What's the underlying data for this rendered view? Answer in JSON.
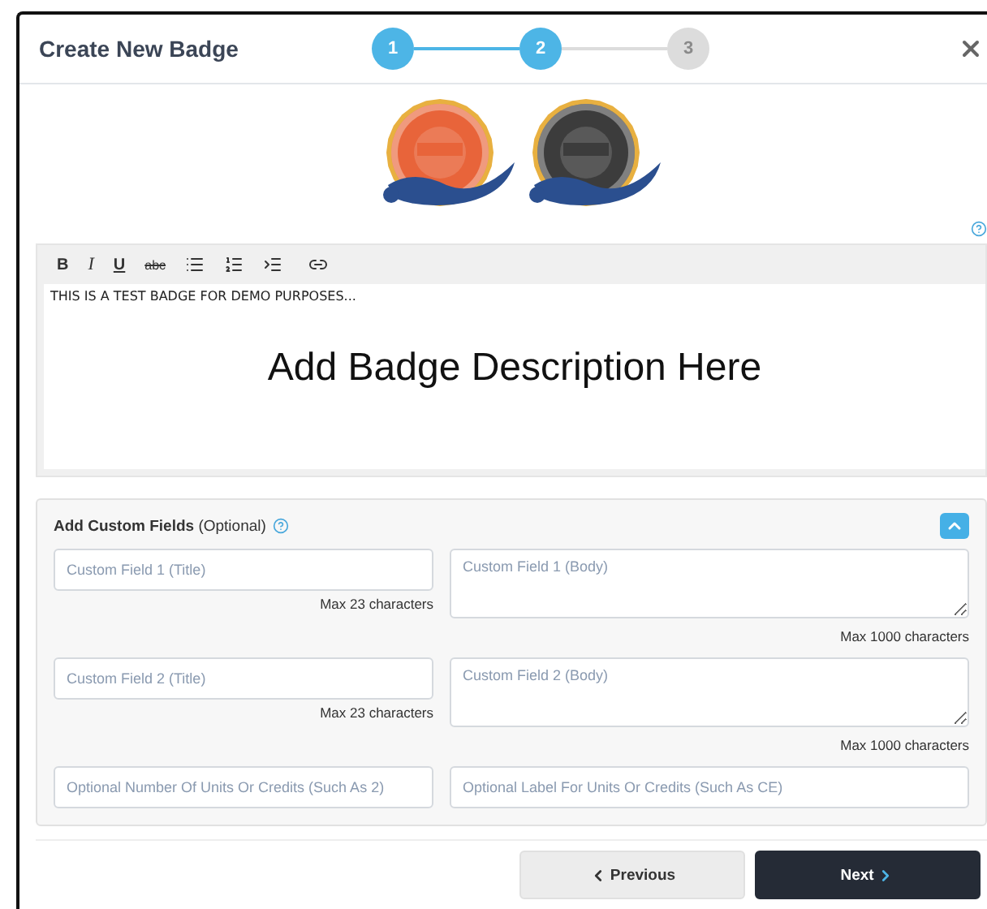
{
  "dialog": {
    "title": "Create New Badge"
  },
  "steps": [
    {
      "label": "1",
      "reached": true
    },
    {
      "label": "2",
      "reached": true
    },
    {
      "label": "3",
      "reached": false
    }
  ],
  "editor": {
    "toolbar": [
      {
        "kind": "bold",
        "label": "B"
      },
      {
        "kind": "italic",
        "label": "I"
      },
      {
        "kind": "underline",
        "label": "U"
      },
      {
        "kind": "strike",
        "label": "abc"
      },
      {
        "kind": "bullet-list"
      },
      {
        "kind": "numbered-list"
      },
      {
        "kind": "indent"
      },
      {
        "kind": "link"
      }
    ],
    "text": "THIS IS A TEST BADGE FOR DEMO PURPOSES...",
    "overlay": "Add Badge Description Here"
  },
  "custom_fields": {
    "title": "Add Custom Fields",
    "note": "(Optional)",
    "expanded": true,
    "rows": [
      {
        "title_placeholder": "Custom Field 1 (Title)",
        "title_hint": "Max 23 characters",
        "body_placeholder": "Custom Field 1 (Body)",
        "body_hint": "Max 1000 characters"
      },
      {
        "title_placeholder": "Custom Field 2 (Title)",
        "title_hint": "Max 23 characters",
        "body_placeholder": "Custom Field 2 (Body)",
        "body_hint": "Max 1000 characters"
      }
    ],
    "units": {
      "number_placeholder": "Optional Number Of Units Or Credits (Such As 2)",
      "label_placeholder": "Optional Label For Units Or Credits (Such As CE)"
    }
  },
  "buttons": {
    "previous": "Previous",
    "next": "Next"
  }
}
